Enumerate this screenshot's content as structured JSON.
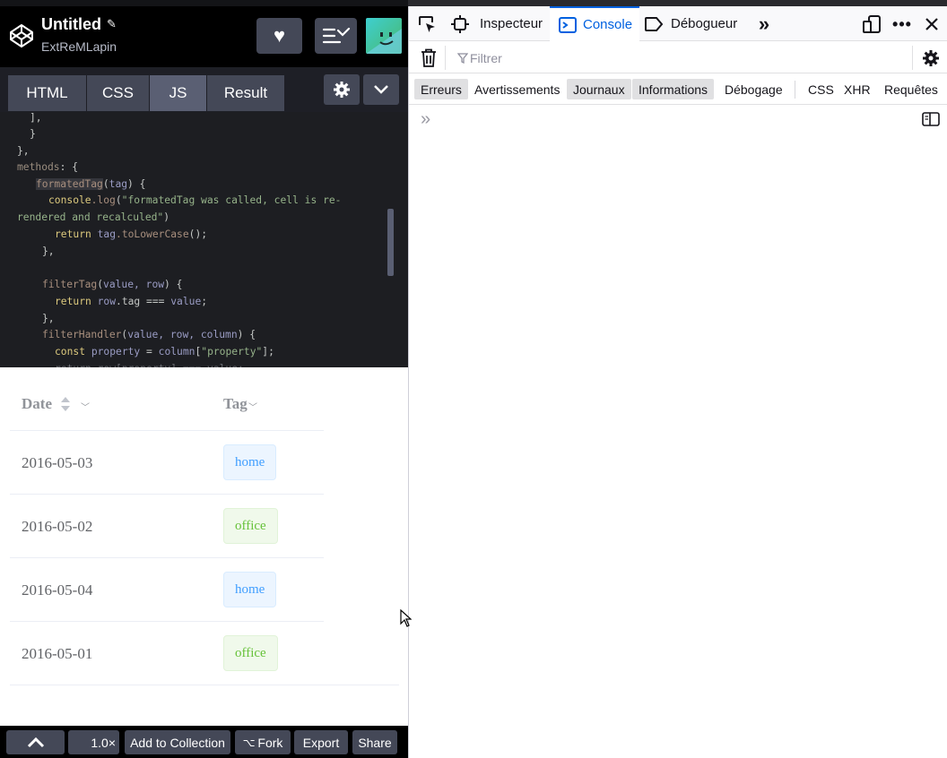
{
  "codepen": {
    "title": "Untitled",
    "author": "ExtReMLapin",
    "tabs": [
      "HTML",
      "CSS",
      "JS",
      "Result"
    ],
    "code": {
      "l1": "],",
      "l2": "}",
      "l3": "},",
      "l4_kw": "methods",
      "l4_rest": ": {",
      "l5_fn": "formatedTag",
      "l5_arg": "tag",
      "l5_rest": ") {",
      "l6_obj": "console",
      "l6_fn": ".log",
      "l6_str": "\"formatedTag was called, cell is re-",
      "l7_str": "rendered and recalculed\"",
      "l7_rest": ")",
      "l8_kw": "return",
      "l8_var": "tag",
      "l8_fn": ".toLowerCase",
      "l8_rest": "();",
      "l9": "},",
      "l10_fn": "filterTag",
      "l10_args": "value, row",
      "l10_rest": ") {",
      "l11_kw": "return",
      "l11_var": "row",
      "l11_mid": ".tag === ",
      "l11_var2": "value",
      "l11_rest": ";",
      "l12": "},",
      "l13_fn": "filterHandler",
      "l13_args": "value, row, column",
      "l13_rest": ") {",
      "l14_kw": "const",
      "l14_var": "property",
      "l14_mid": " = ",
      "l14_var2": "column",
      "l14_str": "\"property\"",
      "l14_rest": "];"
    },
    "table": {
      "headers": {
        "date": "Date",
        "tag": "Tag"
      },
      "rows": [
        {
          "date": "2016-05-03",
          "tag": "home"
        },
        {
          "date": "2016-05-02",
          "tag": "office"
        },
        {
          "date": "2016-05-04",
          "tag": "home"
        },
        {
          "date": "2016-05-01",
          "tag": "office"
        }
      ]
    },
    "footer": {
      "zoom": "1.0×",
      "add_to_collection": "Add to Collection",
      "fork": "Fork",
      "export": "Export",
      "share": "Share"
    }
  },
  "devtools": {
    "tabs": {
      "inspector": "Inspecteur",
      "console": "Console",
      "debugger": "Débogueur"
    },
    "filter_placeholder": "Filtrer",
    "levels": [
      "Erreurs",
      "Avertissements",
      "Journaux",
      "Informations",
      "Débogage",
      "CSS",
      "XHR",
      "Requêtes"
    ],
    "levels_enabled": [
      "Erreurs",
      "Journaux",
      "Informations"
    ],
    "accent_color": "#0061e0"
  }
}
